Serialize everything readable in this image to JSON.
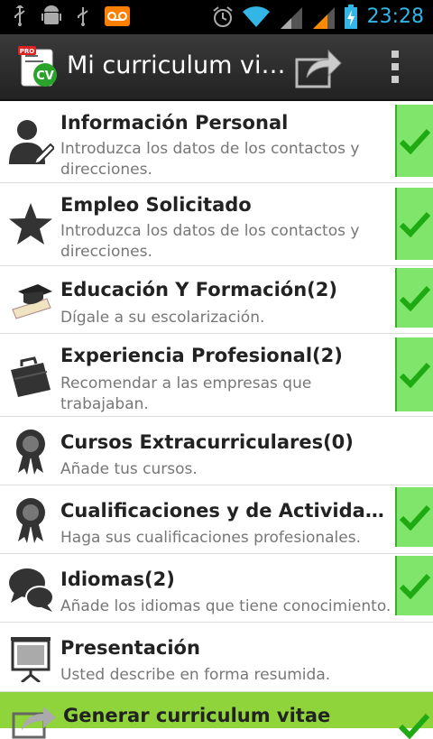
{
  "statusbar": {
    "time": "23:28",
    "icons": [
      "usb-icon",
      "android-debug-icon",
      "usb-icon",
      "voicemail-icon",
      "alarm-icon",
      "wifi-icon",
      "signal-icon",
      "signal-icon",
      "battery-charging-icon"
    ],
    "accent": "#33b5e5"
  },
  "actionbar": {
    "title": "Mi curriculum vi…",
    "app_icon": "cv-pro-app-icon",
    "share_icon": "share-icon",
    "overflow_icon": "overflow-menu-icon"
  },
  "sections": [
    {
      "title": "Información Personal",
      "subtitle": "Introduzca los datos de los contactos y direcciones.",
      "icon": "person-icon",
      "checked": true
    },
    {
      "title": "Empleo Solicitado",
      "subtitle": "Introduzca los datos de los contactos y direcciones.",
      "icon": "star-icon",
      "checked": true
    },
    {
      "title": "Educación Y Formación(2)",
      "subtitle": "Dígale a su escolarización.",
      "icon": "graduation-icon",
      "checked": true
    },
    {
      "title": "Experiencia Profesional(2)",
      "subtitle": "Recomendar a las empresas que trabajaban.",
      "icon": "briefcase-icon",
      "checked": true
    },
    {
      "title": "Cursos Extracurriculares(0)",
      "subtitle": "Añade tus cursos.",
      "icon": "award-ribbon-icon",
      "checked": false
    },
    {
      "title": "Cualificaciones y de Actividades …",
      "subtitle": "Haga sus cualificaciones profesionales.",
      "icon": "award-ribbon-icon",
      "checked": true
    },
    {
      "title": "Idiomas(2)",
      "subtitle": "Añade los idiomas que tiene conocimiento.",
      "icon": "chat-bubbles-icon",
      "checked": true
    },
    {
      "title": "Presentación",
      "subtitle": "Usted describe en forma resumida.",
      "icon": "presentation-board-icon",
      "checked": false
    }
  ],
  "generate": {
    "title": "Generar curriculum vitae",
    "icon": "share-icon"
  },
  "colors": {
    "check_bg": "#7fe66b",
    "check_mark": "#1faa14",
    "generate_bg": "#8ed43a"
  }
}
